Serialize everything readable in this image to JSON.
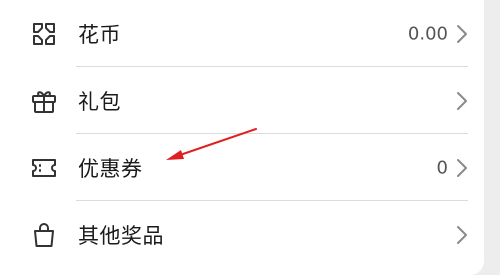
{
  "menu": {
    "items": [
      {
        "label": "花币",
        "value": "0.00",
        "icon": "flower-coin-icon"
      },
      {
        "label": "礼包",
        "value": "",
        "icon": "gift-icon"
      },
      {
        "label": "优惠券",
        "value": "0",
        "icon": "coupon-ticket-icon"
      },
      {
        "label": "其他奖品",
        "value": "",
        "icon": "shopping-bag-icon"
      }
    ]
  },
  "annotation": {
    "color": "#e02020"
  }
}
